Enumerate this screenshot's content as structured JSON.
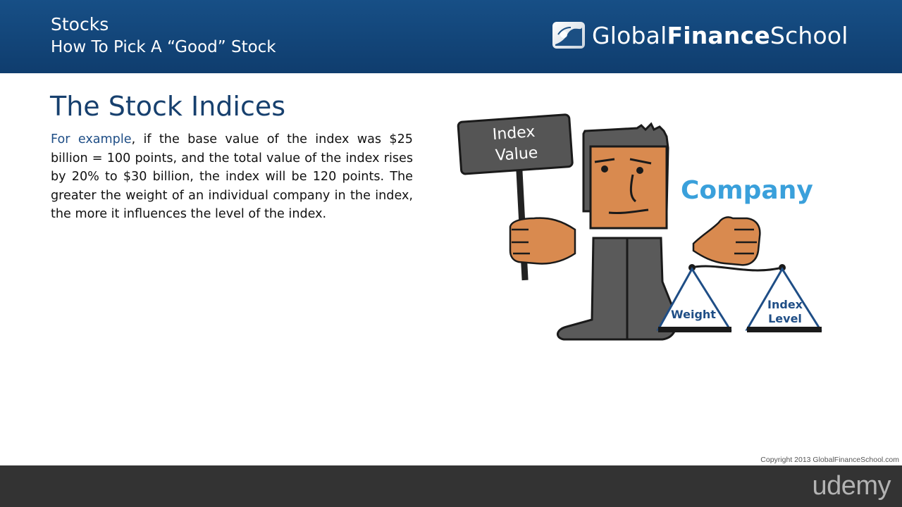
{
  "header": {
    "title": "Stocks",
    "subtitle": "How To Pick A “Good” Stock",
    "logo": {
      "icon": "globe-tree-icon",
      "text_regular_1": "Global",
      "text_bold": "Finance",
      "text_regular_2": "School"
    }
  },
  "slide": {
    "title": "The Stock Indices",
    "para_lead": "For example",
    "para_body": ", if the base value of the index was $25 billion = 100 points, and the total value of the index rises by 20% to $30 billion, the index will be 120 points. The greater the weight of an individual company in the index, the more it influences the level of the index."
  },
  "illustration": {
    "sign_line1": "Index",
    "sign_line2": "Value",
    "company_label": "Company",
    "left_pan_label": "Weight",
    "right_pan_line1": "Index",
    "right_pan_line2": "Level",
    "colors": {
      "company": "#3aa0db",
      "skin": "#d98a4f",
      "suit": "#5a5a5a",
      "pan_label": "#1f4e86"
    }
  },
  "copyright": "Copyright 2013 GlobalFinanceSchool.com",
  "footer": {
    "brand": "udemy"
  }
}
